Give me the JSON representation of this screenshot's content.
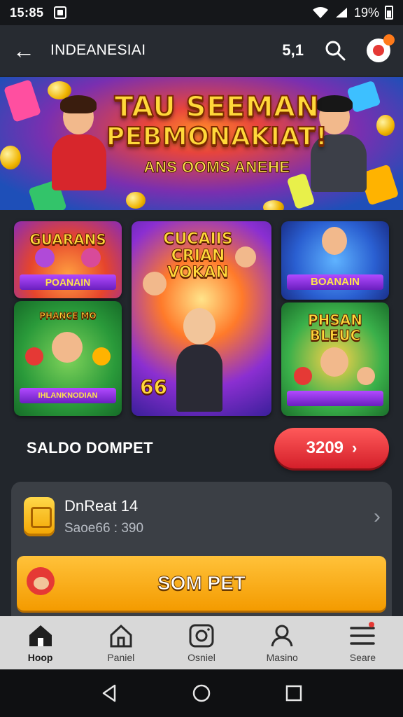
{
  "status_bar": {
    "time": "15:85",
    "battery": "19%"
  },
  "header": {
    "title": "INDEANESIAI",
    "counter": "5,1"
  },
  "hero": {
    "line1": "TAU SEEMAN",
    "line2": "PEBMONAKIAT!",
    "line3": "ANS OOMS ANEHE"
  },
  "games": [
    {
      "title": "GUARANS",
      "banner": "POANAIN"
    },
    {
      "title": "PHANCE MO",
      "banner": "IHLANKNODIAN"
    },
    {
      "title": "CUCAIIS CRIAN VOKAN",
      "banner": "66"
    },
    {
      "title": "",
      "banner": "BOANAIN"
    },
    {
      "title": "PHSAN BLEUC",
      "banner": ""
    }
  ],
  "balance": {
    "label": "SALDO DOMPET",
    "amount": "3209"
  },
  "wallet": {
    "name": "DnReat 14",
    "sub": "Saoe66 : 390",
    "cta": "SOM PET"
  },
  "nav": [
    {
      "label": "Hoop",
      "icon": "home-icon"
    },
    {
      "label": "Paniel",
      "icon": "store-icon"
    },
    {
      "label": "Osniel",
      "icon": "camera-icon"
    },
    {
      "label": "Masino",
      "icon": "profile-icon"
    },
    {
      "label": "Seare",
      "icon": "menu-icon"
    }
  ],
  "colors": {
    "accent": "#d41f2a",
    "cta": "#f49b00",
    "panel": "#3b3f45"
  }
}
